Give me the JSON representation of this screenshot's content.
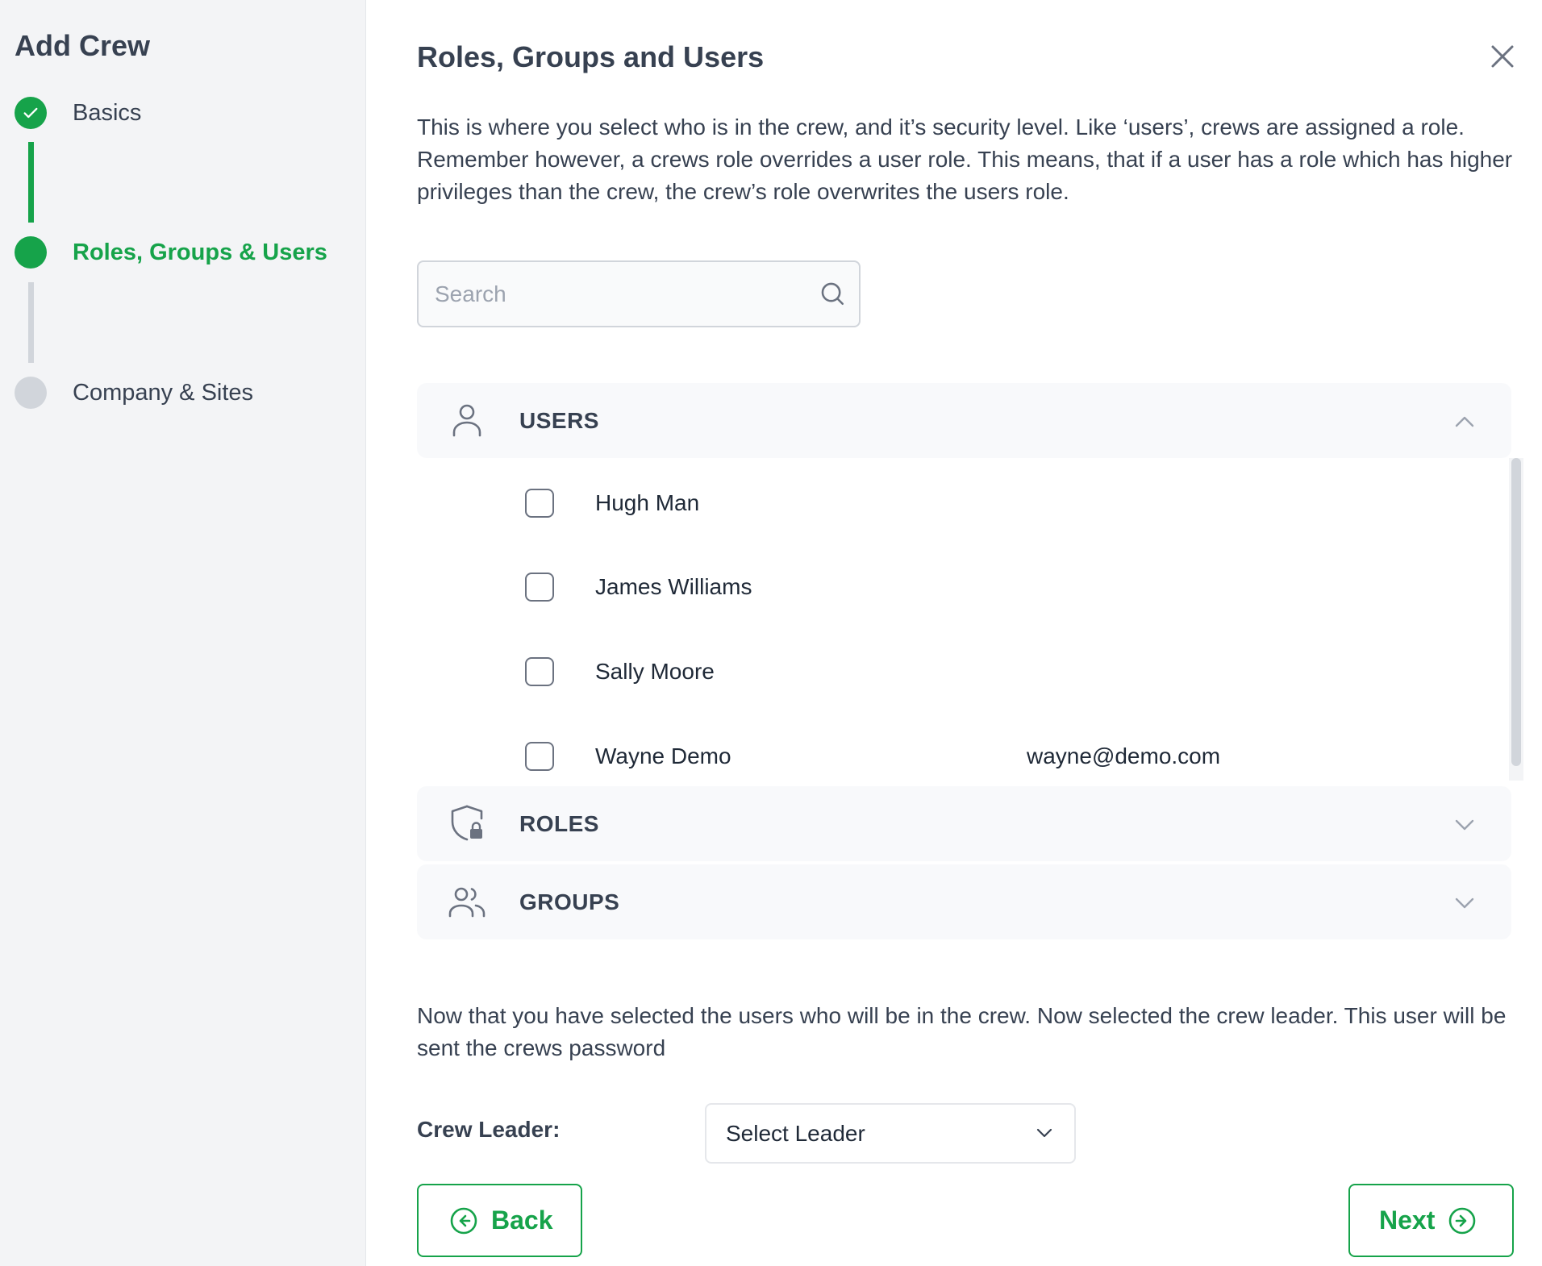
{
  "sidebar": {
    "title": "Add Crew",
    "steps": [
      {
        "label": "Basics",
        "state": "done"
      },
      {
        "label": "Roles, Groups & Users",
        "state": "active"
      },
      {
        "label": "Company & Sites",
        "state": "pending"
      }
    ]
  },
  "main": {
    "title": "Roles, Groups and Users",
    "description": "This is where you select who is in the crew, and it’s security level. Like ‘users’, crews are assigned a role. Remember however, a crews role overrides a user role. This means, that if a user has a role which has higher privileges than the crew, the crew’s role overwrites the users role.",
    "search": {
      "placeholder": "Search",
      "value": ""
    },
    "sections": {
      "users": {
        "label": "USERS",
        "expanded": true
      },
      "roles": {
        "label": "ROLES",
        "expanded": false
      },
      "groups": {
        "label": "GROUPS",
        "expanded": false
      }
    },
    "users": [
      {
        "name": "Hugh Man",
        "email": "",
        "checked": false
      },
      {
        "name": "James Williams",
        "email": "",
        "checked": false
      },
      {
        "name": "Sally Moore",
        "email": "",
        "checked": false
      },
      {
        "name": "Wayne Demo",
        "email": "wayne@demo.com",
        "checked": false
      }
    ],
    "leader_note": "Now that you have selected the users who will be in the crew. Now selected the crew leader. This user will be sent the crews password",
    "leader_label": "Crew Leader:",
    "leader_select": "Select Leader",
    "back_label": "Back",
    "next_label": "Next"
  },
  "colors": {
    "accent": "#16a34a",
    "pending": "#d1d5db",
    "text": "#374151"
  },
  "icons": [
    "check-icon",
    "close-icon",
    "search-icon",
    "user-icon",
    "shield-lock-icon",
    "users-group-icon",
    "chevron-up-icon",
    "chevron-down-icon",
    "arrow-left-circle-icon",
    "arrow-right-circle-icon"
  ]
}
